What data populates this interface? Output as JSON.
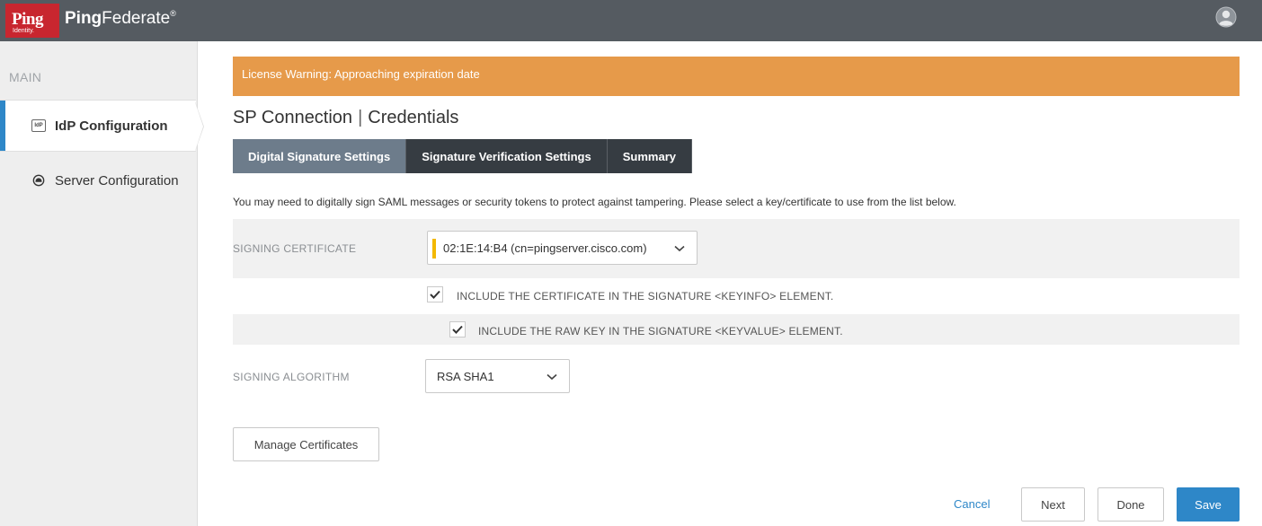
{
  "header": {
    "logo_text": "Ping",
    "logo_subtext": "Identity.",
    "product_bold": "Ping",
    "product_rest": "Federate",
    "product_mark": "®",
    "user_icon": "user-circle-icon"
  },
  "sidebar": {
    "section_label": "MAIN",
    "items": [
      {
        "label": "IdP Configuration",
        "icon": "idp-icon",
        "icon_text": "IdP",
        "active": true
      },
      {
        "label": "Server Configuration",
        "icon": "server-icon",
        "active": false
      }
    ]
  },
  "main": {
    "license_warning": "License Warning: Approaching expiration date",
    "title_left": "SP Connection",
    "title_sep": "|",
    "title_right": "Credentials",
    "tabs": [
      {
        "label": "Digital Signature Settings",
        "active": true
      },
      {
        "label": "Signature Verification Settings",
        "active": false
      },
      {
        "label": "Summary",
        "active": false
      }
    ],
    "description": "You may need to digitally sign SAML messages or security tokens to protect against tampering. Please select a key/certificate to use from the list below.",
    "signing_certificate": {
      "label": "SIGNING CERTIFICATE",
      "value": "02:1E:14:B4 (cn=pingserver.cisco.com)"
    },
    "include_cert": {
      "label": "INCLUDE THE CERTIFICATE IN THE SIGNATURE <KEYINFO> ELEMENT.",
      "checked": true
    },
    "include_raw_key": {
      "label": "INCLUDE THE RAW KEY IN THE SIGNATURE <KEYVALUE> ELEMENT.",
      "checked": true
    },
    "signing_algorithm": {
      "label": "SIGNING ALGORITHM",
      "value": "RSA SHA1"
    },
    "manage_certificates_label": "Manage Certificates"
  },
  "footer": {
    "cancel_label": "Cancel",
    "next_label": "Next",
    "done_label": "Done",
    "save_label": "Save"
  },
  "colors": {
    "topbar": "#555b61",
    "logo_red": "#c8262f",
    "accent_blue": "#2e87c8",
    "warning_orange": "#e69a4a",
    "tab_dark": "#363c42",
    "tab_active": "#6d7c8b",
    "required_yellow": "#f3b800"
  }
}
